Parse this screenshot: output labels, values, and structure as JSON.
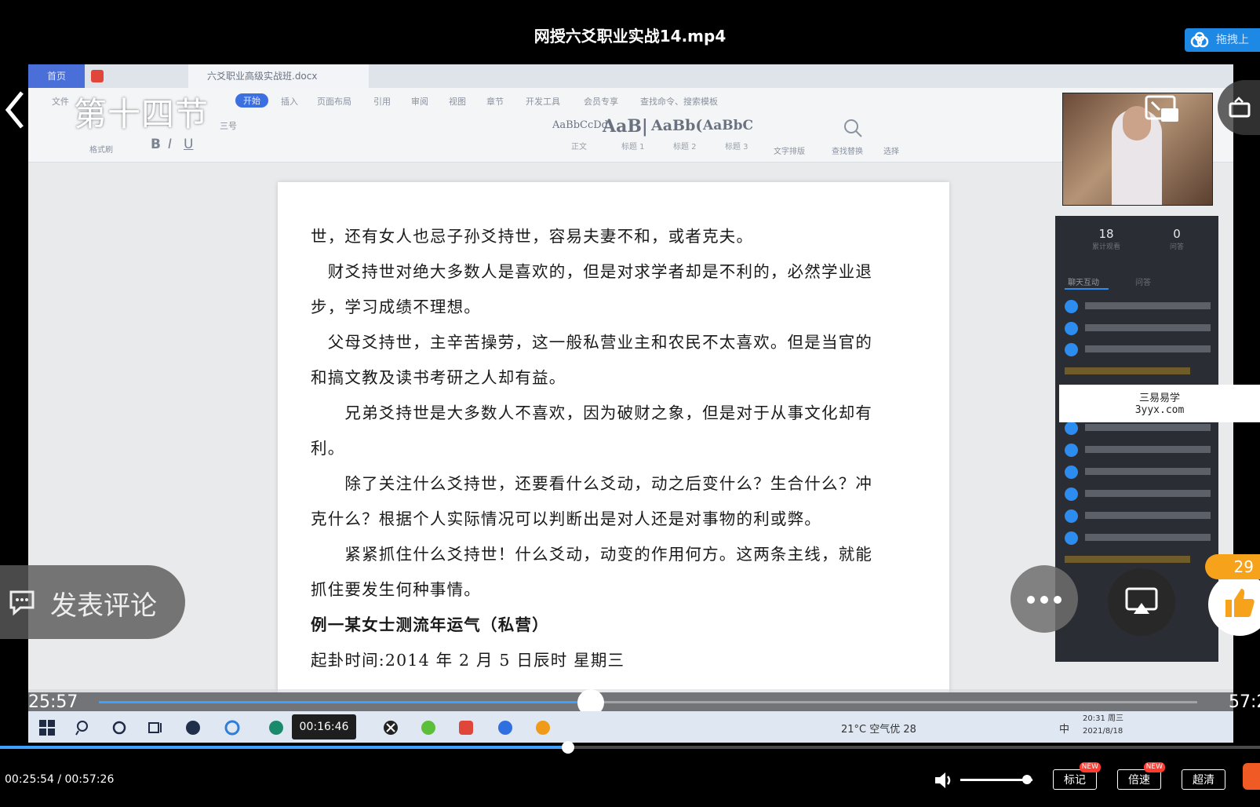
{
  "player": {
    "title": "网授六爻职业实战14.mp4",
    "upload_label": "拖拽上",
    "current_time": "00:25:54",
    "total_time": "00:57:26",
    "time_display": "00:25:54 / 00:57:26",
    "outer_progress": 0.451,
    "hover_time": "00:16:46",
    "buttons": {
      "mark": "标记",
      "speed": "倍速",
      "quality": "超清",
      "new_tag": "NEW"
    },
    "volume": 0.92
  },
  "overlays": {
    "section_title": "第十四节",
    "comment_label": "发表评论",
    "like_count": "29"
  },
  "inner_player": {
    "time_left": "25:57",
    "time_right": "57:2",
    "progress": 0.448
  },
  "wps": {
    "home_tab": "首页",
    "doc_tab": "六爻职业高级实战班.docx",
    "menus": [
      "文件",
      "开始",
      "插入",
      "页面布局",
      "引用",
      "审阅",
      "视图",
      "章节",
      "开发工具",
      "会员专享",
      "查找命令、搜索模板"
    ],
    "styles": [
      {
        "sample": "AaBbCcDd",
        "label": "正文"
      },
      {
        "sample": "AaB|",
        "label": "标题 1"
      },
      {
        "sample": "AaBb(",
        "label": "标题 2"
      },
      {
        "sample": "AaBbC",
        "label": "标题 3"
      }
    ],
    "tools": [
      "文字排版",
      "查找替换",
      "选择"
    ],
    "font_name": "三号",
    "format_painter": "格式刷"
  },
  "document": {
    "paragraphs": [
      "世，还有女人也忌子孙爻持世，容易夫妻不和，或者克夫。",
      "　财爻持世对绝大多数人是喜欢的，但是对求学者却是不利的，必然学业退",
      "步，学习成绩不理想。",
      "　父母爻持世，主辛苦操劳，这一般私营业主和农民不太喜欢。但是当官的",
      "和搞文教及读书考研之人却有益。",
      "　　兄弟爻持世是大多数人不喜欢，因为破财之象，但是对于从事文化却有",
      "利。",
      "　　除了关注什么爻持世，还要看什么爻动，动之后变什么？生合什么？冲",
      "克什么？根据个人实际情况可以判断出是对人还是对事物的利或弊。",
      "　　紧紧抓住什么爻持世！什么爻动，动变的作用何方。这两条主线，就能",
      "抓住要发生何种事情。"
    ],
    "heading": "例一某女士测流年运气（私营）",
    "last_line": "起卦时间:2014 年 2 月 5 日辰时  星期三"
  },
  "chat": {
    "stats": [
      {
        "value": "18",
        "label": "累计观看"
      },
      {
        "value": "0",
        "label": "问答"
      }
    ],
    "tabs": [
      "聊天互动",
      "问答"
    ]
  },
  "watermark": {
    "line1": "三易易学",
    "line2": "3yyx.com"
  },
  "taskbar": {
    "weather": "21°C 空气优 28",
    "ime": "中",
    "clock": "20:31 周三",
    "date": "2021/8/18"
  },
  "colors": {
    "accent": "#3ea1ff",
    "like": "#f7a21b",
    "brand": "#f05a24"
  }
}
